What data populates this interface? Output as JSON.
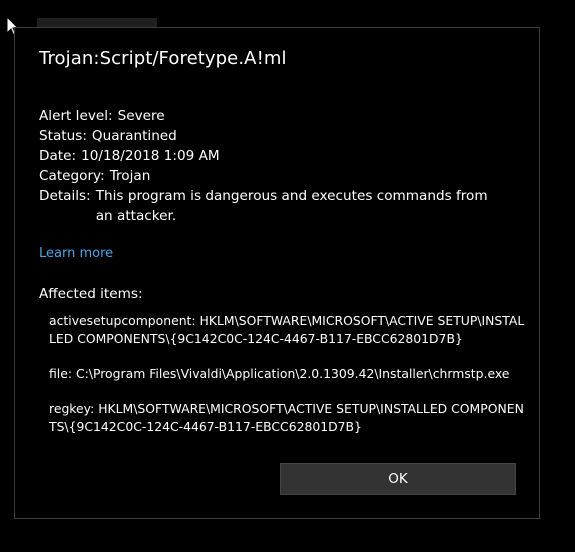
{
  "dialog": {
    "title": "Trojan:Script/Foretype.A!ml",
    "alert_level": {
      "label": "Alert level:",
      "value": "Severe"
    },
    "status": {
      "label": "Status:",
      "value": "Quarantined"
    },
    "date": {
      "label": "Date:",
      "value": "10/18/2018 1:09 AM"
    },
    "category": {
      "label": "Category:",
      "value": "Trojan"
    },
    "details": {
      "label": "Details:",
      "value": "This program is dangerous and executes commands from an attacker."
    },
    "learn_more": "Learn more",
    "affected_heading": "Affected items:",
    "affected_items": [
      "activesetupcomponent: HKLM\\SOFTWARE\\MICROSOFT\\ACTIVE SETUP\\INSTALLED COMPONENTS\\{9C142C0C-124C-4467-B117-EBCC62801D7B}",
      "file: C:\\Program Files\\Vivaldi\\Application\\2.0.1309.42\\Installer\\chrmstp.exe",
      "regkey: HKLM\\SOFTWARE\\MICROSOFT\\ACTIVE SETUP\\INSTALLED COMPONENTS\\{9C142C0C-124C-4467-B117-EBCC62801D7B}"
    ],
    "ok_label": "OK"
  },
  "colors": {
    "background": "#000000",
    "link": "#4aa3e8",
    "button": "#333333",
    "border": "#3c3c3c"
  },
  "icons": {
    "cursor": "mouse-pointer-icon"
  }
}
